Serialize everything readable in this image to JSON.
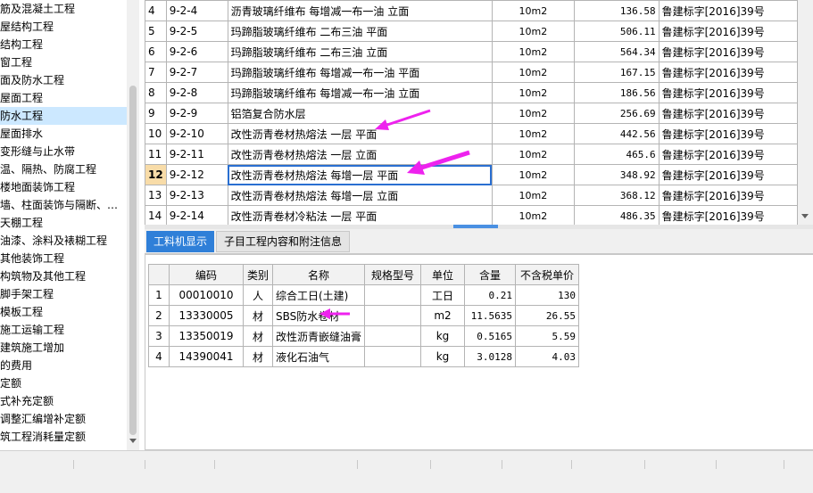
{
  "tree": {
    "items": [
      {
        "label": "筋及混凝土工程"
      },
      {
        "label": "屋结构工程"
      },
      {
        "label": "结构工程"
      },
      {
        "label": "窗工程"
      },
      {
        "label": "面及防水工程"
      },
      {
        "label": "屋面工程"
      },
      {
        "label": "防水工程",
        "selected": true
      },
      {
        "label": "屋面排水"
      },
      {
        "label": "变形缝与止水带"
      },
      {
        "label": "温、隔热、防腐工程"
      },
      {
        "label": "楼地面装饰工程"
      },
      {
        "label": "墙、柱面装饰与隔断、…"
      },
      {
        "label": "天棚工程"
      },
      {
        "label": "油漆、涂料及裱糊工程"
      },
      {
        "label": "其他装饰工程"
      },
      {
        "label": "构筑物及其他工程"
      },
      {
        "label": "脚手架工程"
      },
      {
        "label": "模板工程"
      },
      {
        "label": "施工运输工程"
      },
      {
        "label": "建筑施工增加"
      },
      {
        "label": "的费用"
      },
      {
        "label": "定额"
      },
      {
        "label": "式补充定额"
      },
      {
        "label": "调整汇编增补定额"
      },
      {
        "label": "筑工程消耗量定额"
      }
    ]
  },
  "quota_table": {
    "rows": [
      {
        "idx": "4",
        "code": "9-2-4",
        "name": "沥青玻璃纤维布 每增减一布一油 立面",
        "unit": "10m2",
        "price": "136.58",
        "basis": "鲁建标字[2016]39号"
      },
      {
        "idx": "5",
        "code": "9-2-5",
        "name": "玛蹄脂玻璃纤维布 二布三油 平面",
        "unit": "10m2",
        "price": "506.11",
        "basis": "鲁建标字[2016]39号"
      },
      {
        "idx": "6",
        "code": "9-2-6",
        "name": "玛蹄脂玻璃纤维布 二布三油 立面",
        "unit": "10m2",
        "price": "564.34",
        "basis": "鲁建标字[2016]39号"
      },
      {
        "idx": "7",
        "code": "9-2-7",
        "name": "玛蹄脂玻璃纤维布 每增减一布一油 平面",
        "unit": "10m2",
        "price": "167.15",
        "basis": "鲁建标字[2016]39号"
      },
      {
        "idx": "8",
        "code": "9-2-8",
        "name": "玛蹄脂玻璃纤维布 每增减一布一油 立面",
        "unit": "10m2",
        "price": "186.56",
        "basis": "鲁建标字[2016]39号"
      },
      {
        "idx": "9",
        "code": "9-2-9",
        "name": "铝箔复合防水层",
        "unit": "10m2",
        "price": "256.69",
        "basis": "鲁建标字[2016]39号"
      },
      {
        "idx": "10",
        "code": "9-2-10",
        "name": "改性沥青卷材热熔法 一层 平面",
        "unit": "10m2",
        "price": "442.56",
        "basis": "鲁建标字[2016]39号"
      },
      {
        "idx": "11",
        "code": "9-2-11",
        "name": "改性沥青卷材热熔法 一层 立面",
        "unit": "10m2",
        "price": "465.6",
        "basis": "鲁建标字[2016]39号"
      },
      {
        "idx": "12",
        "code": "9-2-12",
        "name": "改性沥青卷材热熔法 每增一层 平面",
        "unit": "10m2",
        "price": "348.92",
        "basis": "鲁建标字[2016]39号",
        "selected": true
      },
      {
        "idx": "13",
        "code": "9-2-13",
        "name": "改性沥青卷材热熔法 每增一层 立面",
        "unit": "10m2",
        "price": "368.12",
        "basis": "鲁建标字[2016]39号"
      },
      {
        "idx": "14",
        "code": "9-2-14",
        "name": "改性沥青卷材冷粘法 一层 平面",
        "unit": "10m2",
        "price": "486.35",
        "basis": "鲁建标字[2016]39号"
      }
    ]
  },
  "tabs": {
    "resources": "工料机显示",
    "notes": "子目工程内容和附注信息"
  },
  "resource_table": {
    "headers": [
      "",
      "编码",
      "类别",
      "名称",
      "规格型号",
      "单位",
      "含量",
      "不含税单价"
    ],
    "rows": [
      {
        "idx": "1",
        "code": "00010010",
        "type": "人",
        "name": "综合工日(土建)",
        "spec": "",
        "unit": "工日",
        "qty": "0.21",
        "price": "130"
      },
      {
        "idx": "2",
        "code": "13330005",
        "type": "材",
        "name": "SBS防水卷材",
        "spec": "",
        "unit": "m2",
        "qty": "11.5635",
        "price": "26.55"
      },
      {
        "idx": "3",
        "code": "13350019",
        "type": "材",
        "name": "改性沥青嵌缝油膏",
        "spec": "",
        "unit": "kg",
        "qty": "0.5165",
        "price": "5.59"
      },
      {
        "idx": "4",
        "code": "14390041",
        "type": "材",
        "name": "液化石油气",
        "spec": "",
        "unit": "kg",
        "qty": "3.0128",
        "price": "4.03"
      }
    ]
  },
  "colors": {
    "annotation_arrow": "#ee22ee",
    "selection": "#cce8ff",
    "tab_active": "#2f7fd8"
  }
}
